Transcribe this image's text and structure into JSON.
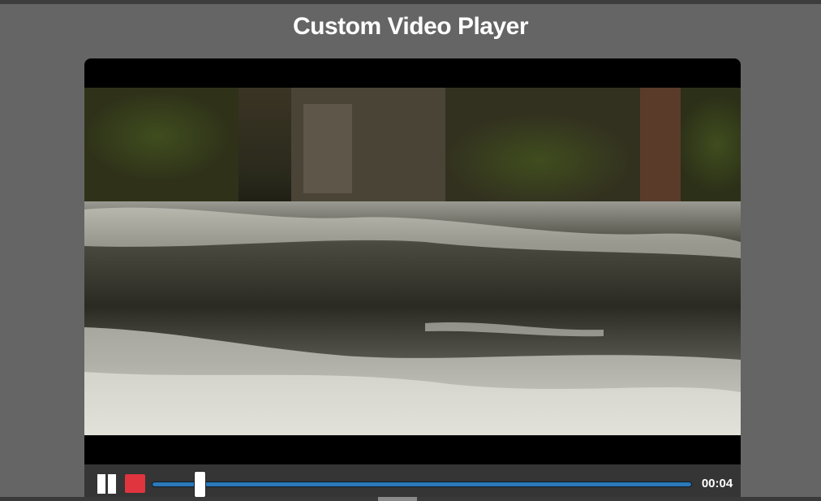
{
  "page": {
    "title": "Custom Video Player"
  },
  "player": {
    "elapsed_time": "00:04",
    "progress_fraction": 0.09,
    "state": "playing",
    "controls": {
      "pause_icon": "pause-icon",
      "stop_icon": "stop-icon"
    }
  },
  "colors": {
    "page_background": "#656565",
    "controls_background": "#353535",
    "progress_fill": "#2c78b8",
    "stop_button": "#e0343f"
  }
}
